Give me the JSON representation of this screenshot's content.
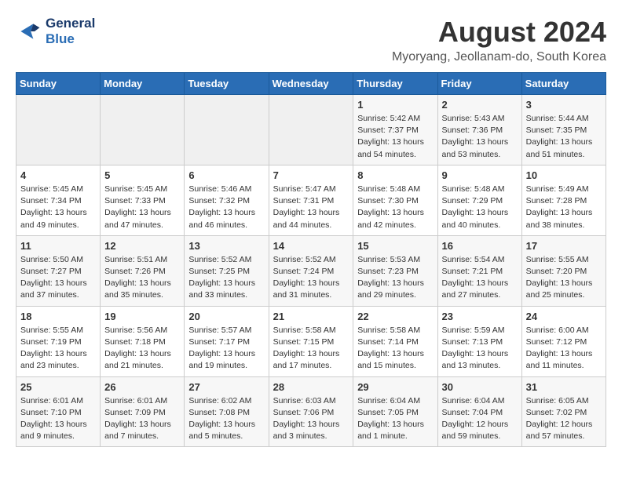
{
  "logo": {
    "line1": "General",
    "line2": "Blue"
  },
  "title": "August 2024",
  "location": "Myoryang, Jeollanam-do, South Korea",
  "days_header": [
    "Sunday",
    "Monday",
    "Tuesday",
    "Wednesday",
    "Thursday",
    "Friday",
    "Saturday"
  ],
  "weeks": [
    [
      {
        "day": "",
        "info": ""
      },
      {
        "day": "",
        "info": ""
      },
      {
        "day": "",
        "info": ""
      },
      {
        "day": "",
        "info": ""
      },
      {
        "day": "1",
        "info": "Sunrise: 5:42 AM\nSunset: 7:37 PM\nDaylight: 13 hours\nand 54 minutes."
      },
      {
        "day": "2",
        "info": "Sunrise: 5:43 AM\nSunset: 7:36 PM\nDaylight: 13 hours\nand 53 minutes."
      },
      {
        "day": "3",
        "info": "Sunrise: 5:44 AM\nSunset: 7:35 PM\nDaylight: 13 hours\nand 51 minutes."
      }
    ],
    [
      {
        "day": "4",
        "info": "Sunrise: 5:45 AM\nSunset: 7:34 PM\nDaylight: 13 hours\nand 49 minutes."
      },
      {
        "day": "5",
        "info": "Sunrise: 5:45 AM\nSunset: 7:33 PM\nDaylight: 13 hours\nand 47 minutes."
      },
      {
        "day": "6",
        "info": "Sunrise: 5:46 AM\nSunset: 7:32 PM\nDaylight: 13 hours\nand 46 minutes."
      },
      {
        "day": "7",
        "info": "Sunrise: 5:47 AM\nSunset: 7:31 PM\nDaylight: 13 hours\nand 44 minutes."
      },
      {
        "day": "8",
        "info": "Sunrise: 5:48 AM\nSunset: 7:30 PM\nDaylight: 13 hours\nand 42 minutes."
      },
      {
        "day": "9",
        "info": "Sunrise: 5:48 AM\nSunset: 7:29 PM\nDaylight: 13 hours\nand 40 minutes."
      },
      {
        "day": "10",
        "info": "Sunrise: 5:49 AM\nSunset: 7:28 PM\nDaylight: 13 hours\nand 38 minutes."
      }
    ],
    [
      {
        "day": "11",
        "info": "Sunrise: 5:50 AM\nSunset: 7:27 PM\nDaylight: 13 hours\nand 37 minutes."
      },
      {
        "day": "12",
        "info": "Sunrise: 5:51 AM\nSunset: 7:26 PM\nDaylight: 13 hours\nand 35 minutes."
      },
      {
        "day": "13",
        "info": "Sunrise: 5:52 AM\nSunset: 7:25 PM\nDaylight: 13 hours\nand 33 minutes."
      },
      {
        "day": "14",
        "info": "Sunrise: 5:52 AM\nSunset: 7:24 PM\nDaylight: 13 hours\nand 31 minutes."
      },
      {
        "day": "15",
        "info": "Sunrise: 5:53 AM\nSunset: 7:23 PM\nDaylight: 13 hours\nand 29 minutes."
      },
      {
        "day": "16",
        "info": "Sunrise: 5:54 AM\nSunset: 7:21 PM\nDaylight: 13 hours\nand 27 minutes."
      },
      {
        "day": "17",
        "info": "Sunrise: 5:55 AM\nSunset: 7:20 PM\nDaylight: 13 hours\nand 25 minutes."
      }
    ],
    [
      {
        "day": "18",
        "info": "Sunrise: 5:55 AM\nSunset: 7:19 PM\nDaylight: 13 hours\nand 23 minutes."
      },
      {
        "day": "19",
        "info": "Sunrise: 5:56 AM\nSunset: 7:18 PM\nDaylight: 13 hours\nand 21 minutes."
      },
      {
        "day": "20",
        "info": "Sunrise: 5:57 AM\nSunset: 7:17 PM\nDaylight: 13 hours\nand 19 minutes."
      },
      {
        "day": "21",
        "info": "Sunrise: 5:58 AM\nSunset: 7:15 PM\nDaylight: 13 hours\nand 17 minutes."
      },
      {
        "day": "22",
        "info": "Sunrise: 5:58 AM\nSunset: 7:14 PM\nDaylight: 13 hours\nand 15 minutes."
      },
      {
        "day": "23",
        "info": "Sunrise: 5:59 AM\nSunset: 7:13 PM\nDaylight: 13 hours\nand 13 minutes."
      },
      {
        "day": "24",
        "info": "Sunrise: 6:00 AM\nSunset: 7:12 PM\nDaylight: 13 hours\nand 11 minutes."
      }
    ],
    [
      {
        "day": "25",
        "info": "Sunrise: 6:01 AM\nSunset: 7:10 PM\nDaylight: 13 hours\nand 9 minutes."
      },
      {
        "day": "26",
        "info": "Sunrise: 6:01 AM\nSunset: 7:09 PM\nDaylight: 13 hours\nand 7 minutes."
      },
      {
        "day": "27",
        "info": "Sunrise: 6:02 AM\nSunset: 7:08 PM\nDaylight: 13 hours\nand 5 minutes."
      },
      {
        "day": "28",
        "info": "Sunrise: 6:03 AM\nSunset: 7:06 PM\nDaylight: 13 hours\nand 3 minutes."
      },
      {
        "day": "29",
        "info": "Sunrise: 6:04 AM\nSunset: 7:05 PM\nDaylight: 13 hours\nand 1 minute."
      },
      {
        "day": "30",
        "info": "Sunrise: 6:04 AM\nSunset: 7:04 PM\nDaylight: 12 hours\nand 59 minutes."
      },
      {
        "day": "31",
        "info": "Sunrise: 6:05 AM\nSunset: 7:02 PM\nDaylight: 12 hours\nand 57 minutes."
      }
    ]
  ]
}
